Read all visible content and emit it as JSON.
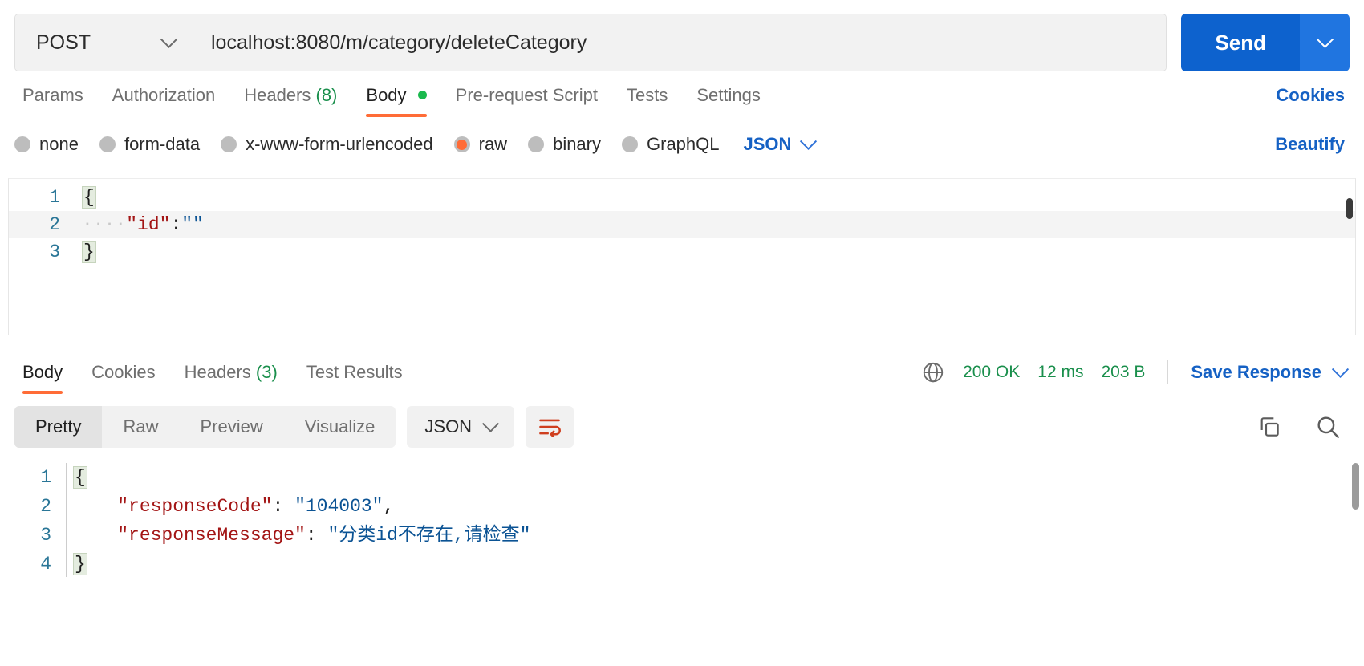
{
  "request": {
    "method": "POST",
    "url": "localhost:8080/m/category/deleteCategory",
    "send_label": "Send",
    "tabs": [
      {
        "label": "Params",
        "count": "",
        "active": false,
        "dot": false
      },
      {
        "label": "Authorization",
        "count": "",
        "active": false,
        "dot": false
      },
      {
        "label": "Headers",
        "count": "(8)",
        "active": false,
        "dot": false
      },
      {
        "label": "Body",
        "count": "",
        "active": true,
        "dot": true
      },
      {
        "label": "Pre-request Script",
        "count": "",
        "active": false,
        "dot": false
      },
      {
        "label": "Tests",
        "count": "",
        "active": false,
        "dot": false
      },
      {
        "label": "Settings",
        "count": "",
        "active": false,
        "dot": false
      }
    ],
    "cookies_label": "Cookies",
    "body_types": [
      {
        "label": "none",
        "selected": false
      },
      {
        "label": "form-data",
        "selected": false
      },
      {
        "label": "x-www-form-urlencoded",
        "selected": false
      },
      {
        "label": "raw",
        "selected": true
      },
      {
        "label": "binary",
        "selected": false
      },
      {
        "label": "GraphQL",
        "selected": false
      }
    ],
    "format": "JSON",
    "beautify_label": "Beautify",
    "body_lines": [
      {
        "num": "1",
        "indent": "",
        "text": "{",
        "brace": true,
        "highlight": false
      },
      {
        "num": "2",
        "indent": "····",
        "key": "\"id\"",
        "colon": ":",
        "value": "\"\"",
        "highlight": true
      },
      {
        "num": "3",
        "indent": "",
        "text": "}",
        "brace": true,
        "highlight": false
      }
    ]
  },
  "response": {
    "tabs": [
      {
        "label": "Body",
        "count": "",
        "active": true
      },
      {
        "label": "Cookies",
        "count": "",
        "active": false
      },
      {
        "label": "Headers",
        "count": "(3)",
        "active": false
      },
      {
        "label": "Test Results",
        "count": "",
        "active": false
      }
    ],
    "status": "200 OK",
    "time": "12 ms",
    "size": "203 B",
    "save_label": "Save Response",
    "view_modes": [
      {
        "label": "Pretty",
        "active": true
      },
      {
        "label": "Raw",
        "active": false
      },
      {
        "label": "Preview",
        "active": false
      },
      {
        "label": "Visualize",
        "active": false
      }
    ],
    "format": "JSON",
    "body_lines": [
      {
        "num": "1",
        "text": "{",
        "brace": true
      },
      {
        "num": "2",
        "key": "\"responseCode\"",
        "colon": ": ",
        "value": "\"104003\"",
        "trail": ","
      },
      {
        "num": "3",
        "key": "\"responseMessage\"",
        "colon": ": ",
        "value": "\"分类id不存在,请检查\"",
        "trail": ""
      },
      {
        "num": "4",
        "text": "}",
        "brace": true
      }
    ]
  },
  "colors": {
    "accent_orange": "#ff6c37",
    "link_blue": "#1561c4",
    "send_blue": "#0d62ce",
    "status_green": "#1a8f4c",
    "json_key": "#a31515",
    "json_string": "#0b5394"
  }
}
